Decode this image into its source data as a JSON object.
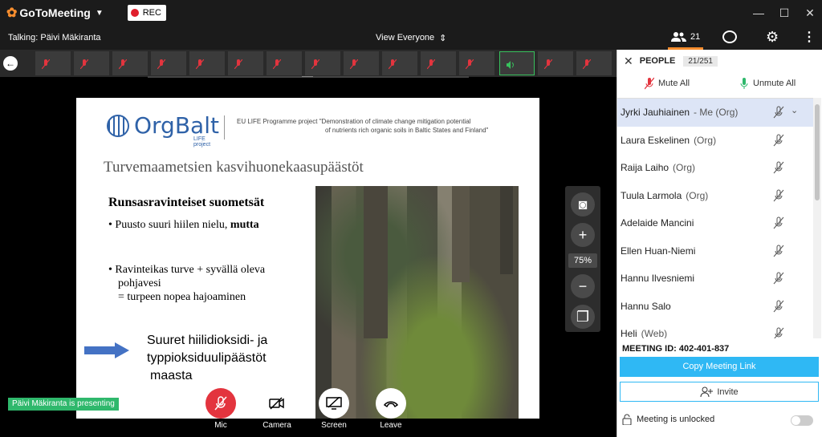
{
  "app": {
    "name": "GoToMeeting",
    "rec_label": "REC"
  },
  "window_controls": {
    "minimize": "—",
    "maximize": "☐",
    "close": "✕"
  },
  "infobar": {
    "talking": "Talking: Päivi Mäkiranta",
    "view": "View Everyone"
  },
  "tabs": {
    "people_count": "21"
  },
  "stage": {
    "zoom": "75%",
    "presenting": "Päivi Mäkiranta is presenting",
    "slide": {
      "logo_name": "OrgBalt",
      "logo_sub": "LIFE project",
      "project_line1": "EU LIFE Programme project \"Demonstration of climate change mitigation potential",
      "project_line2": "of nutrients rich organic soils in Baltic States and Finland\"",
      "title": "Turvemaametsien kasvihuonekaasupäästöt",
      "heading": "Runsasravinteiset suometsät",
      "bullet1_a": "Puusto suuri hiilen nielu, ",
      "bullet1_b": "mutta",
      "bullet2_l1": "Ravinteikas turve + syvällä oleva",
      "bullet2_l2": "pohjavesi",
      "bullet2_l3": "= turpeen nopea hajoaminen",
      "conclusion_l1": "Suuret hiilidioksidi- ja",
      "conclusion_l2": "typpioksiduulipäästöt",
      "conclusion_l3": "maasta"
    }
  },
  "controls": {
    "mic": "Mic",
    "camera": "Camera",
    "screen": "Screen",
    "leave": "Leave"
  },
  "people_panel": {
    "title": "PEOPLE",
    "count": "21/251",
    "mute_all": "Mute All",
    "unmute_all": "Unmute All",
    "people": [
      {
        "name": "Jyrki Jauhiainen",
        "tag": "- Me (Org)"
      },
      {
        "name": "Laura Eskelinen",
        "tag": "(Org)"
      },
      {
        "name": "Raija Laiho",
        "tag": "(Org)"
      },
      {
        "name": "Tuula Larmola",
        "tag": "(Org)"
      },
      {
        "name": "Adelaide Mancini",
        "tag": ""
      },
      {
        "name": "Ellen Huan-Niemi",
        "tag": ""
      },
      {
        "name": "Hannu Ilvesniemi",
        "tag": ""
      },
      {
        "name": "Hannu Salo",
        "tag": ""
      },
      {
        "name": "Heli",
        "tag": "(Web)"
      }
    ],
    "meeting_id_label": "MEETING ID:",
    "meeting_id": "402-401-837",
    "copy_link": "Copy Meeting Link",
    "invite": "Invite",
    "lock_status": "Meeting is unlocked"
  },
  "colors": {
    "accent_orange": "#f68d2e",
    "rec_red": "#e01e2c",
    "mic_red": "#e3343e",
    "link_blue": "#2fb8f4",
    "presenting_green": "#2fb86c"
  }
}
